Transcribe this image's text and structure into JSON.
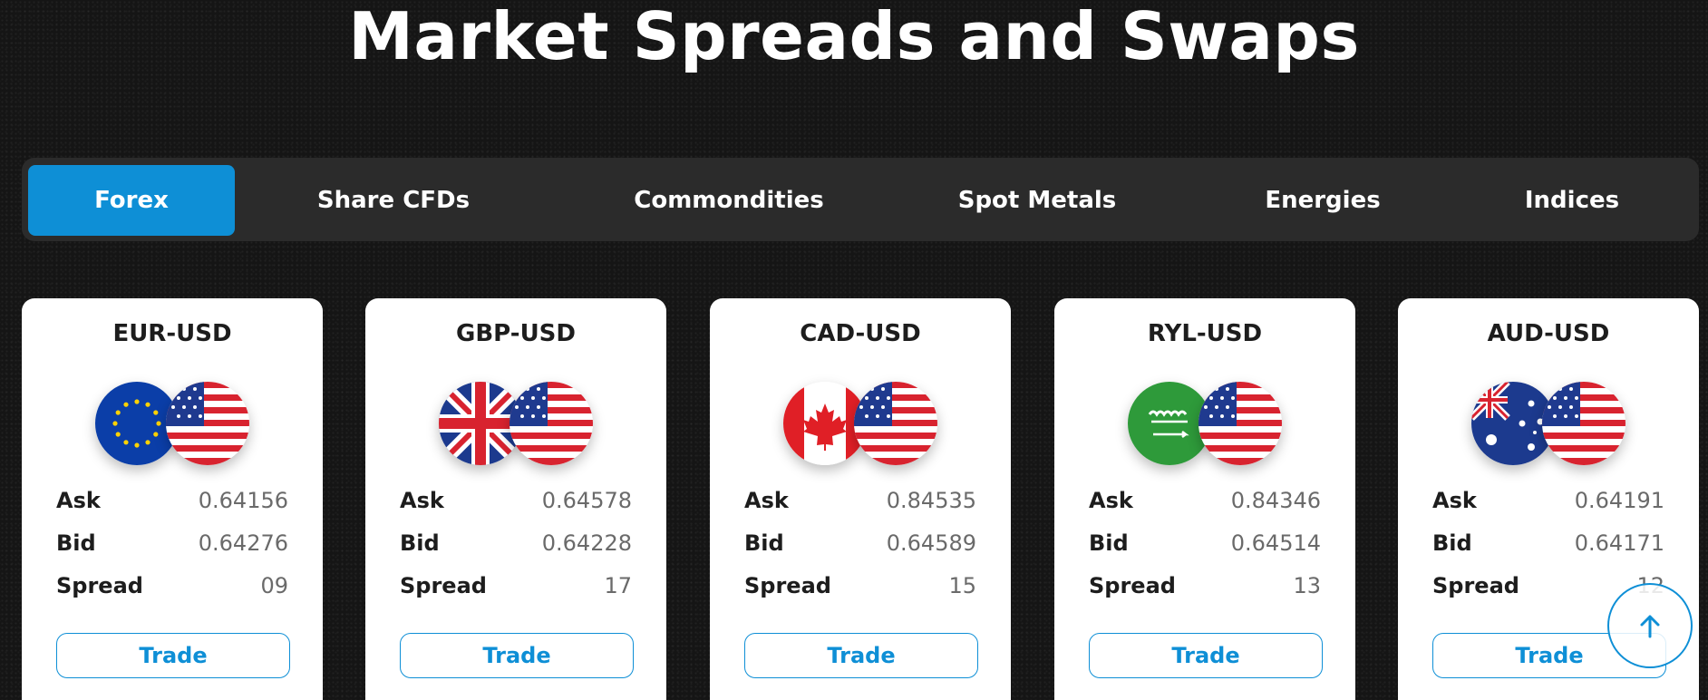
{
  "page": {
    "title": "Market Spreads and Swaps"
  },
  "tabs": [
    {
      "label": "Forex",
      "active": true
    },
    {
      "label": "Share CFDs",
      "active": false
    },
    {
      "label": "Commondities",
      "active": false
    },
    {
      "label": "Spot Metals",
      "active": false
    },
    {
      "label": "Energies",
      "active": false
    },
    {
      "label": "Indices",
      "active": false
    }
  ],
  "row_labels": {
    "ask": "Ask",
    "bid": "Bid",
    "spread": "Spread"
  },
  "trade_label": "Trade",
  "cards": [
    {
      "pair": "EUR-USD",
      "base_flag": "eu-flag-icon",
      "quote_flag": "us-flag-icon",
      "ask": "0.64156",
      "bid": "0.64276",
      "spread": "09"
    },
    {
      "pair": "GBP-USD",
      "base_flag": "uk-flag-icon",
      "quote_flag": "us-flag-icon",
      "ask": "0.64578",
      "bid": "0.64228",
      "spread": "17"
    },
    {
      "pair": "CAD-USD",
      "base_flag": "canada-flag-icon",
      "quote_flag": "us-flag-icon",
      "ask": "0.84535",
      "bid": "0.64589",
      "spread": "15"
    },
    {
      "pair": "RYL-USD",
      "base_flag": "saudi-flag-icon",
      "quote_flag": "us-flag-icon",
      "ask": "0.84346",
      "bid": "0.64514",
      "spread": "13"
    },
    {
      "pair": "AUD-USD",
      "base_flag": "australia-flag-icon",
      "quote_flag": "us-flag-icon",
      "ask": "0.64191",
      "bid": "0.64171",
      "spread": "12"
    }
  ],
  "colors": {
    "accent": "#0e8fd6",
    "tabbar": "#2b2b2b",
    "background": "#151515"
  },
  "scroll_top_icon": "arrow-up-icon"
}
